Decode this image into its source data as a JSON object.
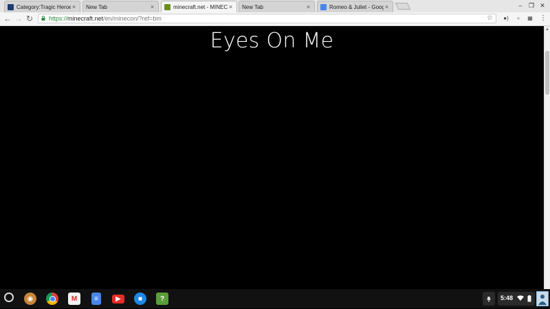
{
  "tabs": [
    {
      "title": "Category:Tragic Heroes",
      "active": false
    },
    {
      "title": "New Tab",
      "active": false
    },
    {
      "title": "minecraft.net - MINECON",
      "active": true
    },
    {
      "title": "New Tab",
      "active": false
    },
    {
      "title": "Romeo & Juliet - Google",
      "active": false
    }
  ],
  "omnibox": {
    "scheme": "https://",
    "host": "minecraft.net",
    "path": "/en/minecon/?ref=bm"
  },
  "page": {
    "heading": "Eyes On Me"
  },
  "shelf": {
    "apps": [
      "chrome-launcher",
      "chrome",
      "gmail",
      "docs",
      "youtube",
      "files",
      "unknown-app"
    ],
    "clock": "5:48"
  },
  "colors": {
    "page_bg": "#000000",
    "heading_color": "#ffffff",
    "secure_green": "#2e8b3e"
  }
}
